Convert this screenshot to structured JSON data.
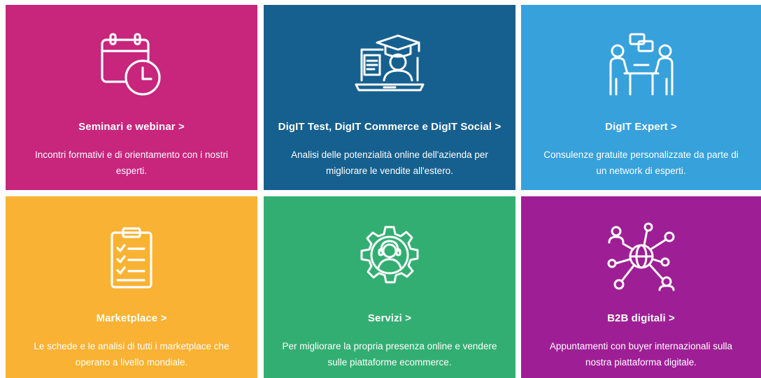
{
  "cards": [
    {
      "title": "Seminari e webinar >",
      "description": "Incontri formativi e di orientamento con i nostri esperti.",
      "icon": "calendar-clock-icon",
      "color": "#c8257c"
    },
    {
      "title": "DigIT Test, DigIT Commerce e DigIT Social >",
      "description": "Analisi delle potenzialità online dell'azienda per migliorare le vendite all'estero.",
      "icon": "laptop-graduation-icon",
      "color": "#16608f"
    },
    {
      "title": "DigIT Expert >",
      "description": "Consulenze gratuite personalizzate da parte di un network di esperti.",
      "icon": "consultation-table-icon",
      "color": "#37a1dc"
    },
    {
      "title": "Marketplace >",
      "description": "Le schede e le analisi di tutti i marketplace che operano a livello mondiale.",
      "icon": "clipboard-checklist-icon",
      "color": "#f9b233"
    },
    {
      "title": "Servizi >",
      "description": "Per migliorare la propria presenza online e vendere sulle piattaforme ecommerce.",
      "icon": "gear-support-agent-icon",
      "color": "#33ae72"
    },
    {
      "title": "B2B digitali >",
      "description": "Appuntamenti con buyer internazionali sulla nostra piattaforma digitale.",
      "icon": "globe-network-people-icon",
      "color": "#9e1f95"
    }
  ]
}
